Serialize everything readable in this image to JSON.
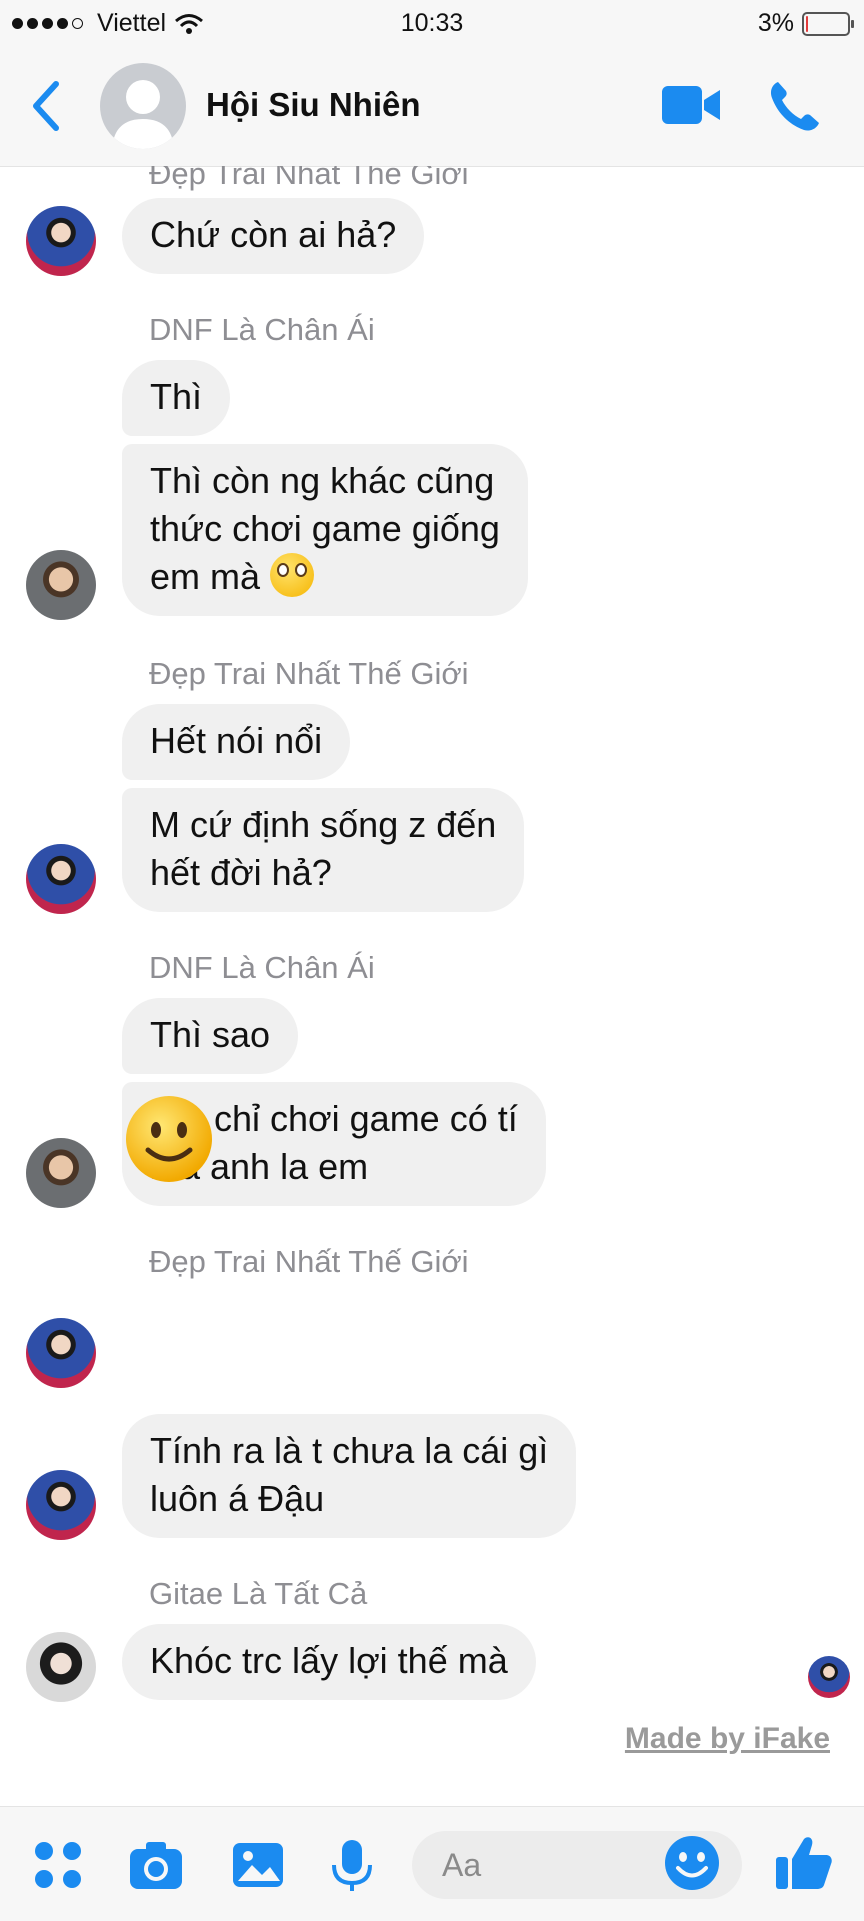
{
  "status_bar": {
    "carrier": "Viettel",
    "signal_bars": 4,
    "signal_bars_total": 5,
    "time": "10:33",
    "battery": "3%",
    "battery_level": 0.03
  },
  "header": {
    "title": "Hội Siu Nhiên",
    "icons": [
      "back-icon",
      "video-camera-icon",
      "phone-icon"
    ]
  },
  "messages": [
    {
      "sender": "Đẹp Trai Nhất Thế Giới",
      "avatar": "a",
      "bubbles": [
        "Chứ còn ai hả?"
      ]
    },
    {
      "sender": "DNF Là Chân Ái",
      "avatar": "b",
      "bubbles": [
        "Thì",
        "Thì còn ng khác cũng\nthức chơi game giống\nem mà"
      ]
    },
    {
      "sender": "Đẹp Trai Nhất Thế Giới",
      "avatar": "a",
      "bubbles": [
        "Hết nói nổi",
        "M cứ định sống z đến\nhết đời hả?"
      ]
    },
    {
      "sender": "DNF Là Chân Ái",
      "avatar": "b",
      "bubbles": [
        "Thì sao",
        "Em chỉ chơi game có tí\nmà anh la em"
      ]
    },
    {
      "sender": "Đẹp Trai Nhất Thế Giới",
      "avatar": "a",
      "bubbles": [
        "slightly-smiling-face-emoji",
        "Tính ra là t chưa la cái gì\nluôn á Đậu"
      ]
    },
    {
      "sender": "Gitae Là Tất Cả",
      "avatar": "c",
      "bubbles": [
        "Khóc trc lấy lợi thế mà"
      ]
    }
  ],
  "watermark": "Made by iFake",
  "composer": {
    "placeholder": "Aa",
    "icons": [
      "apps-icon",
      "camera-icon",
      "photo-icon",
      "microphone-icon",
      "emoji-icon",
      "thumbs-up-icon"
    ]
  },
  "colors": {
    "accent": "#1b8bf0",
    "bubble": "#f0f0f0",
    "sender_text": "#8e8e93",
    "bar_background": "#f7f7f7"
  }
}
